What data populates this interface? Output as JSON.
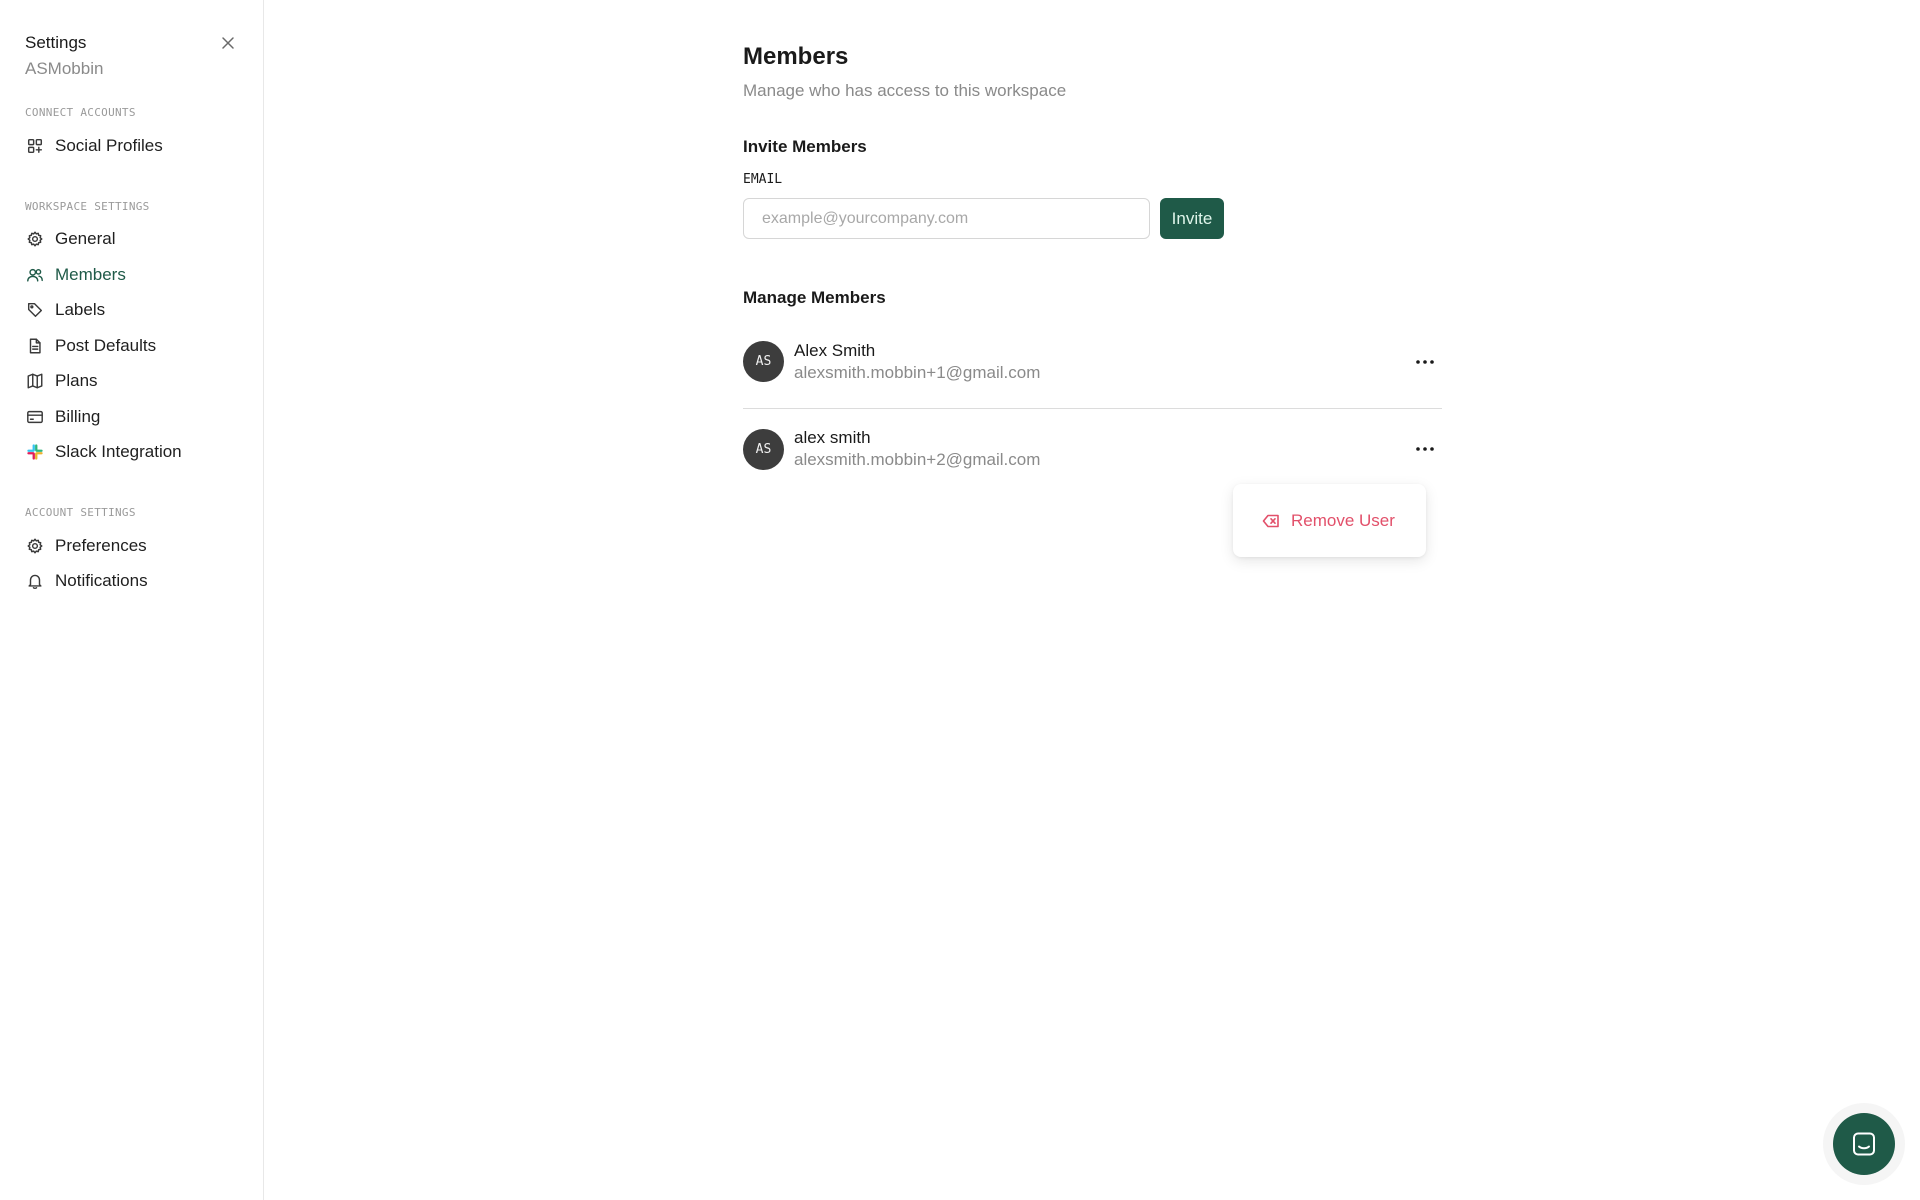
{
  "sidebar": {
    "title": "Settings",
    "workspace": "ASMobbin",
    "sections": [
      {
        "label": "CONNECT ACCOUNTS",
        "items": [
          {
            "label": "Social Profiles",
            "icon": "grid-plus-icon"
          }
        ]
      },
      {
        "label": "WORKSPACE SETTINGS",
        "items": [
          {
            "label": "General",
            "icon": "gear-icon"
          },
          {
            "label": "Members",
            "icon": "users-icon",
            "active": true
          },
          {
            "label": "Labels",
            "icon": "tag-icon"
          },
          {
            "label": "Post Defaults",
            "icon": "document-icon"
          },
          {
            "label": "Plans",
            "icon": "map-icon"
          },
          {
            "label": "Billing",
            "icon": "credit-card-icon"
          },
          {
            "label": "Slack Integration",
            "icon": "slack-icon"
          }
        ]
      },
      {
        "label": "ACCOUNT SETTINGS",
        "items": [
          {
            "label": "Preferences",
            "icon": "gear-icon"
          },
          {
            "label": "Notifications",
            "icon": "bell-icon"
          }
        ]
      }
    ]
  },
  "main": {
    "title": "Members",
    "subtitle": "Manage who has access to this workspace",
    "invite": {
      "title": "Invite Members",
      "email_label": "EMAIL",
      "email_placeholder": "example@yourcompany.com",
      "email_value": "",
      "button_label": "Invite"
    },
    "manage": {
      "title": "Manage Members",
      "members": [
        {
          "initials": "AS",
          "name": "Alex Smith",
          "email": "alexsmith.mobbin+1@gmail.com"
        },
        {
          "initials": "AS",
          "name": "alex smith",
          "email": "alexsmith.mobbin+2@gmail.com"
        }
      ]
    },
    "dropdown": {
      "items": [
        {
          "label": "Remove User",
          "icon": "remove-user-icon"
        }
      ]
    }
  },
  "colors": {
    "accent": "#1f5a48",
    "danger": "#e2506a",
    "muted_text": "#8a8a8a",
    "avatar_bg": "#3d3d3d"
  }
}
